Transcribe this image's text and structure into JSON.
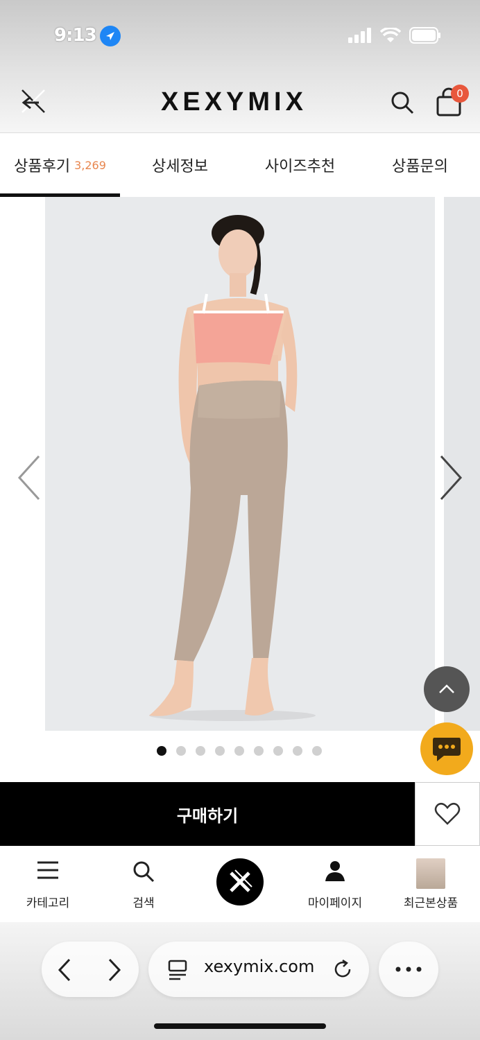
{
  "status_bar": {
    "time": "9:13"
  },
  "header": {
    "logo": "XEXYMIX",
    "cart_count": "0"
  },
  "tabs": [
    {
      "label": "상품후기",
      "count": "3,269"
    },
    {
      "label": "상세정보"
    },
    {
      "label": "사이즈추천"
    },
    {
      "label": "상품문의"
    }
  ],
  "gallery": {
    "dot_count": 9,
    "active_index": 0
  },
  "buy_bar": {
    "buy_label": "구매하기"
  },
  "bottom_nav": {
    "items": [
      {
        "label": "카테고리"
      },
      {
        "label": "검색"
      },
      {
        "label": "마이페이지"
      },
      {
        "label": "최근본상품"
      }
    ]
  },
  "browser": {
    "url": "xexymix.com"
  },
  "colors": {
    "accent": "#e8864e",
    "chat": "#f2aa1c",
    "badge": "#e8573c"
  }
}
